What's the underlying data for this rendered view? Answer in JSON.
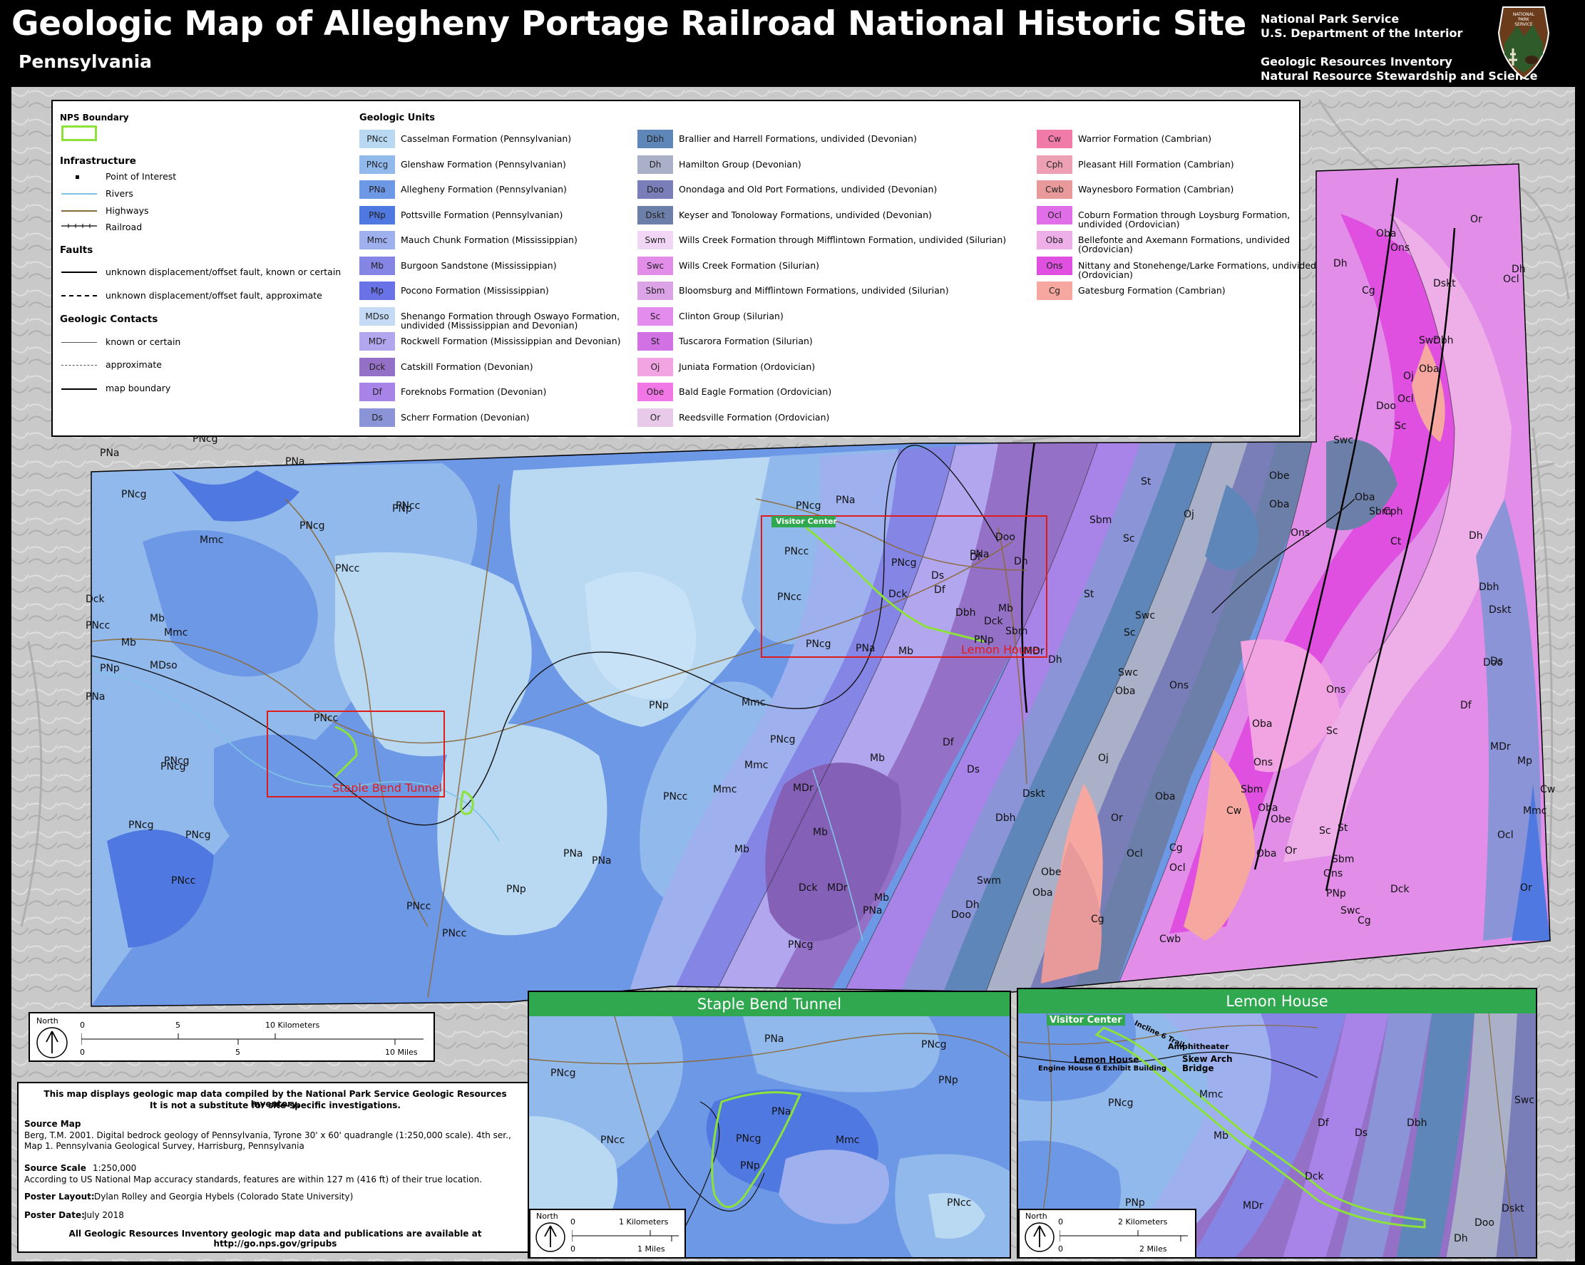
{
  "header": {
    "title": "Geologic Map of Allegheny Portage Railroad National Historic Site",
    "subtitle": "Pennsylvania",
    "agency_line1": "National Park Service",
    "agency_line2": "U.S. Department of the Interior",
    "agency_line3": "Geologic Resources Inventory",
    "agency_line4": "Natural Resource Stewardship and Science",
    "logo_text": "NATIONAL PARK SERVICE"
  },
  "legend": {
    "nps_boundary": "NPS Boundary",
    "infrastructure": "Infrastructure",
    "poi": "Point of Interest",
    "rivers": "Rivers",
    "highways": "Highways",
    "railroad": "Railroad",
    "faults": "Faults",
    "fault_known": "unknown displacement/offset fault, known or certain",
    "fault_approx": "unknown displacement/offset fault, approximate",
    "contacts": "Geologic Contacts",
    "contact_known": "known or certain",
    "contact_approx": "approximate",
    "map_boundary": "map boundary",
    "geologic_units": "Geologic Units",
    "units": [
      {
        "code": "PNcc",
        "name": "Casselman Formation (Pennsylvanian)",
        "color": "#b9d9f3"
      },
      {
        "code": "PNcg",
        "name": "Glenshaw Formation (Pennsylvanian)",
        "color": "#91b9ec"
      },
      {
        "code": "PNa",
        "name": "Allegheny Formation (Pennsylvanian)",
        "color": "#6d98e6"
      },
      {
        "code": "PNp",
        "name": "Pottsville Formation (Pennsylvanian)",
        "color": "#4f78e0"
      },
      {
        "code": "Mmc",
        "name": "Mauch Chunk Formation (Mississippian)",
        "color": "#9eb0ee"
      },
      {
        "code": "Mb",
        "name": "Burgoon Sandstone (Mississippian)",
        "color": "#8585e6"
      },
      {
        "code": "Mp",
        "name": "Pocono Formation (Mississippian)",
        "color": "#6a72e8"
      },
      {
        "code": "MDso",
        "name": "Shenango Formation through Oswayo Formation, undivided (Mississippian and Devonian)",
        "color": "#c5dbf5"
      },
      {
        "code": "MDr",
        "name": "Rockwell Formation (Mississippian and Devonian)",
        "color": "#b2a6ee"
      },
      {
        "code": "Dck",
        "name": "Catskill Formation (Devonian)",
        "color": "#9471c6"
      },
      {
        "code": "Df",
        "name": "Foreknobs Formation (Devonian)",
        "color": "#a883e8"
      },
      {
        "code": "Ds",
        "name": "Scherr Formation (Devonian)",
        "color": "#8a94d6"
      },
      {
        "code": "Dbh",
        "name": "Brallier and Harrell Formations, undivided (Devonian)",
        "color": "#5e86b8"
      },
      {
        "code": "Dh",
        "name": "Hamilton Group (Devonian)",
        "color": "#aab0c8"
      },
      {
        "code": "Doo",
        "name": "Onondaga and Old Port Formations, undivided (Devonian)",
        "color": "#7a7eb8"
      },
      {
        "code": "Dskt",
        "name": "Keyser and Tonoloway Formations, undivided (Devonian)",
        "color": "#6c7fa8"
      },
      {
        "code": "Swm",
        "name": "Wills Creek Formation through Mifflintown Formation, undivided (Silurian)",
        "color": "#f1d6f6"
      },
      {
        "code": "Swc",
        "name": "Wills Creek Formation (Silurian)",
        "color": "#e28de8"
      },
      {
        "code": "Sbm",
        "name": "Bloomsburg and Mifflintown Formations, undivided (Silurian)",
        "color": "#dca4e6"
      },
      {
        "code": "Sc",
        "name": "Clinton Group (Silurian)",
        "color": "#e38ced"
      },
      {
        "code": "St",
        "name": "Tuscarora Formation (Silurian)",
        "color": "#d271e4"
      },
      {
        "code": "Oj",
        "name": "Juniata Formation (Ordovician)",
        "color": "#f1a4e1"
      },
      {
        "code": "Obe",
        "name": "Bald Eagle Formation (Ordovician)",
        "color": "#f177e6"
      },
      {
        "code": "Or",
        "name": "Reedsville Formation (Ordovician)",
        "color": "#e9c9ea"
      },
      {
        "code": "Cw",
        "name": "Warrior Formation (Cambrian)",
        "color": "#f07aa8"
      },
      {
        "code": "Cph",
        "name": "Pleasant Hill Formation (Cambrian)",
        "color": "#eda0b4"
      },
      {
        "code": "Cwb",
        "name": "Waynesboro Formation (Cambrian)",
        "color": "#e89a9a"
      },
      {
        "code": "Ocl",
        "name": "Coburn Formation through Loysburg Formation, undivided (Ordovician)",
        "color": "#e06ee8"
      },
      {
        "code": "Oba",
        "name": "Bellefonte and Axemann Formations, undivided (Ordovician)",
        "color": "#eeaee8"
      },
      {
        "code": "Ons",
        "name": "Nittany and Stonehenge/Larke Formations, undivided (Ordovician)",
        "color": "#df4fe0"
      },
      {
        "code": "Cg",
        "name": "Gatesburg Formation (Cambrian)",
        "color": "#f6a8a0"
      }
    ]
  },
  "map": {
    "site_labels": {
      "visitor_center": "Visitor Center",
      "lemon_house": "Lemon House",
      "staple_bend": "Staple Bend Tunnel"
    },
    "unit_labels": [
      "PNcg",
      "Mmc",
      "PNcg",
      "PNp",
      "PNa",
      "PNa",
      "PNcg",
      "PNcg",
      "PNcc",
      "Mmc",
      "PNcc",
      "PNp",
      "Dck",
      "Mb",
      "PNcc",
      "PNp",
      "Mmc",
      "MDso",
      "Mb",
      "PNa",
      "PNcg",
      "PNcc",
      "PNcg",
      "PNcg",
      "PNcc",
      "PNcc",
      "PNcc",
      "PNcg",
      "PNa",
      "PNp",
      "PNa",
      "Mmc",
      "PNcg",
      "PNa",
      "PNp",
      "PNcc",
      "PNcg",
      "PNa",
      "PNcc",
      "PNcc",
      "PNcg",
      "PNa",
      "Mmc",
      "MDr",
      "Mb",
      "Mb",
      "Dck",
      "Mb",
      "MDr",
      "Mb",
      "Df",
      "Ds",
      "Dbh",
      "Swm",
      "Dh",
      "Doo",
      "PNa",
      "PNcg",
      "PNcg",
      "Mmc",
      "Mb",
      "Dck",
      "Df",
      "Ds",
      "Dbh",
      "Doo",
      "Dh",
      "Df",
      "Dck",
      "Mb",
      "MDr",
      "PNp",
      "Dh",
      "Dskt",
      "St",
      "Sbm",
      "Sc",
      "Swc",
      "Sbm",
      "Sc",
      "St",
      "Swc",
      "Oba",
      "Ons",
      "Or",
      "Oj",
      "Obe",
      "Oba",
      "Ocl",
      "Cg",
      "Oba",
      "Ocl",
      "Cg",
      "Cwb",
      "Oba",
      "Cw",
      "Ons",
      "Oba",
      "Obe",
      "Ons",
      "Or",
      "St",
      "Sbm",
      "Sc",
      "Swc",
      "Cg",
      "Oba",
      "Ons",
      "Oj",
      "Doo",
      "Ct",
      "Cph",
      "Oba",
      "Ocl",
      "Sc",
      "Oba",
      "Sbm",
      "Oj",
      "Swc",
      "Dskt",
      "Dh",
      "Dbh",
      "Doo",
      "Ds",
      "Df",
      "MDr",
      "Mp",
      "Mmc",
      "Dck",
      "PNp",
      "Or",
      "Ocl",
      "Cw",
      "Obe",
      "Sc",
      "Sbm",
      "Swc",
      "Dh",
      "Dskt",
      "Dbh",
      "Dh",
      "Cg",
      "Oba",
      "Ons",
      "Obe",
      "Oba",
      "Ons",
      "Or",
      "Ocl",
      "Sc",
      "Cw",
      "Oj",
      "Cg"
    ]
  },
  "insets": {
    "staple_title": "Staple Bend Tunnel",
    "lemon_title": "Lemon House",
    "lemon_labels": {
      "visitor_center": "Visitor Center",
      "incline": "Incline 6 Trail",
      "amphitheater": "Amphitheater",
      "lemon_house": "Lemon House",
      "engine_house": "Engine House 6 Exhibit Building",
      "skew_arch": "Skew Arch Bridge"
    }
  },
  "scalebars": {
    "north": "North",
    "main_km": "10 Kilometers",
    "main_mi": "10 Miles",
    "main_km_ticks": [
      "0",
      "5"
    ],
    "main_mi_ticks": [
      "0",
      "5"
    ],
    "staple_km": "1 Kilometers",
    "staple_mi": "1 Miles",
    "staple_ticks": [
      "0",
      "0"
    ],
    "lemon_km": "2 Kilometers",
    "lemon_mi": "2 Miles",
    "lemon_ticks": [
      "0",
      "0"
    ]
  },
  "notes": {
    "intro1": "This map displays geologic map data compiled by the National Park Service Geologic Resources Inventory.",
    "intro2": "It is not a substitute for site-specific investigations.",
    "source_map_h": "Source Map",
    "source_map": "Berg, T.M. 2001. Digital bedrock geology of Pennsylvania, Tyrone 30' x 60' quadrangle (1:250,000 scale). 4th ser., Map 1. Pennsylvania Geological Survey, Harrisburg, Pennsylvania",
    "source_scale_h": "Source Scale",
    "source_scale_val": "1:250,000",
    "source_scale": "According to US National Map accuracy standards, features are within 127 m (416 ft) of their true location.",
    "poster_layout_h": "Poster Layout:",
    "poster_layout": "Dylan Rolley and Georgia Hybels (Colorado State University)",
    "poster_date_h": "Poster Date:",
    "poster_date": "July 2018",
    "footer": "All Geologic Resources Inventory geologic map data and publications are available at http://go.nps.gov/gripubs"
  }
}
